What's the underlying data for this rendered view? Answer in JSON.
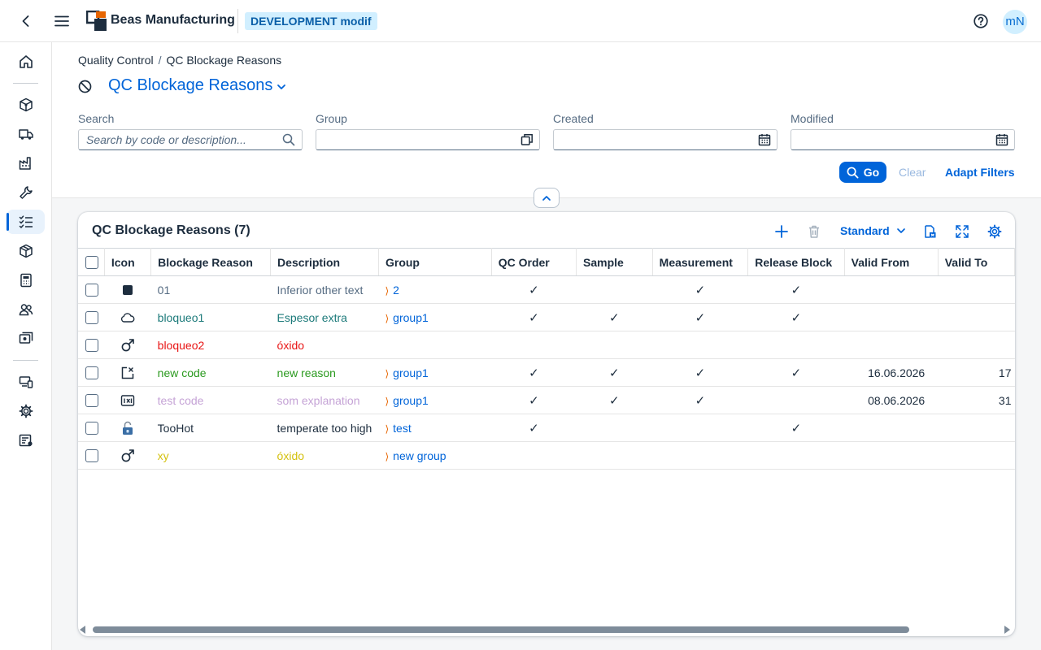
{
  "shell": {
    "brand": "Beas Manufacturing",
    "environment": "DEVELOPMENT modif",
    "avatar_initials": "mN",
    "accent_color": "#0064d9"
  },
  "breadcrumb": {
    "parent": "Quality Control",
    "current": "QC Blockage Reasons"
  },
  "page": {
    "title": "QC Blockage Reasons"
  },
  "filters": {
    "search_label": "Search",
    "search_placeholder": "Search by code or description...",
    "group_label": "Group",
    "created_label": "Created",
    "modified_label": "Modified",
    "go_label": "Go",
    "clear_label": "Clear",
    "adapt_label": "Adapt Filters"
  },
  "table": {
    "title": "QC Blockage Reasons (7)",
    "variant": "Standard",
    "columns": [
      "Icon",
      "Blockage Reason",
      "Description",
      "Group",
      "QC Order",
      "Sample",
      "Measurement",
      "Release Block",
      "Valid From",
      "Valid To"
    ],
    "rows": [
      {
        "icon": "square-filled-icon",
        "reason": "01",
        "description": "Inferior other text",
        "group": "2",
        "text_color": "#556b82",
        "qc_order": true,
        "sample": false,
        "measurement": true,
        "release_block": true,
        "valid_from": "",
        "valid_to": ""
      },
      {
        "icon": "cloud-icon",
        "reason": "bloqueo1",
        "description": "Espesor extra",
        "group": "group1",
        "text_color": "#1c7a7a",
        "qc_order": true,
        "sample": true,
        "measurement": true,
        "release_block": true,
        "valid_from": "",
        "valid_to": ""
      },
      {
        "icon": "male-icon",
        "reason": "bloqueo2",
        "description": "óxido",
        "group": "",
        "text_color": "#e81515",
        "qc_order": false,
        "sample": false,
        "measurement": false,
        "release_block": false,
        "valid_from": "",
        "valid_to": ""
      },
      {
        "icon": "exit-full-screen-icon",
        "reason": "new code",
        "description": "new reason",
        "group": "group1",
        "text_color": "#2b9a1f",
        "qc_order": true,
        "sample": true,
        "measurement": true,
        "release_block": true,
        "valid_from": "16.06.2026",
        "valid_to": "17"
      },
      {
        "icon": "size-badge-icon",
        "reason": "test code",
        "description": "som explanation",
        "group": "group1",
        "text_color": "#c5a3d6",
        "qc_order": true,
        "sample": true,
        "measurement": true,
        "release_block": false,
        "valid_from": "08.06.2026",
        "valid_to": "31"
      },
      {
        "icon": "unlocked-icon",
        "reason": "TooHot",
        "description": "temperate too high",
        "group": "test",
        "text_color": "#1d2d3e",
        "qc_order": true,
        "sample": false,
        "measurement": false,
        "release_block": true,
        "valid_from": "",
        "valid_to": ""
      },
      {
        "icon": "male-icon",
        "reason": "xy",
        "description": "óxido",
        "group": "new group",
        "text_color": "#d4c10f",
        "qc_order": false,
        "sample": false,
        "measurement": false,
        "release_block": false,
        "valid_from": "",
        "valid_to": ""
      }
    ]
  }
}
